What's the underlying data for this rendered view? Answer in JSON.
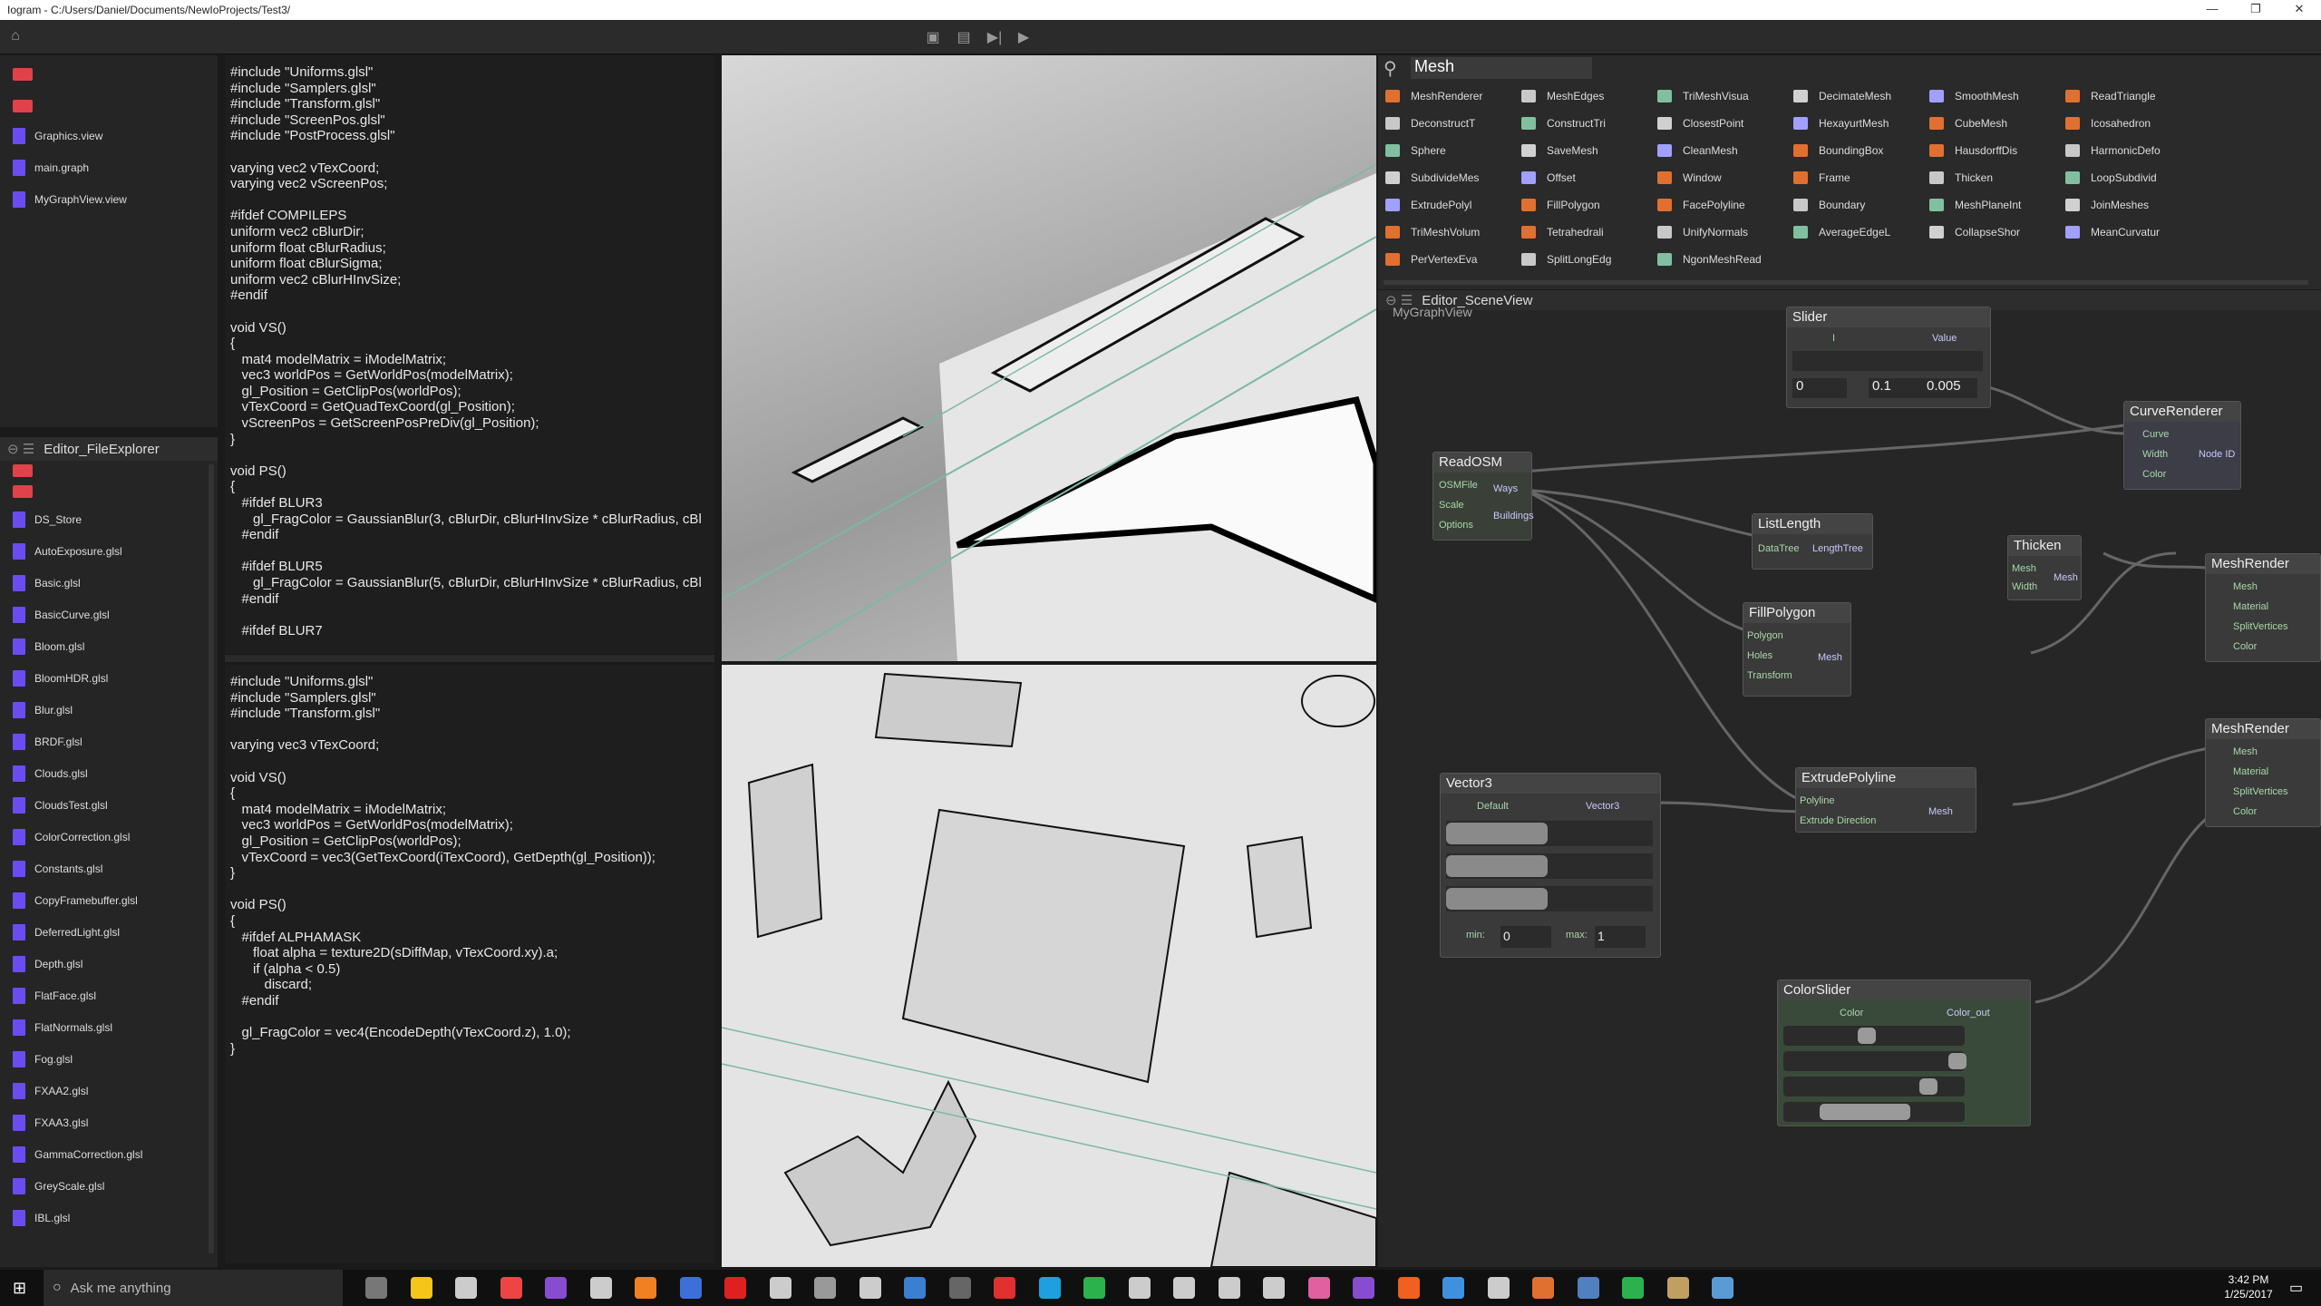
{
  "window": {
    "title": "Iogram - C:/Users/Daniel/Documents/NewIoProjects/Test3/",
    "minimize": "—",
    "maximize": "❐",
    "close": "✕"
  },
  "toolbar": {
    "home_icon": "home-icon",
    "buttons": [
      "open-icon",
      "save-icon",
      "step-icon",
      "play-icon"
    ]
  },
  "project_files": [
    {
      "name": ""
    },
    {
      "name": "."
    },
    {
      "name": "Graphics.view"
    },
    {
      "name": "main.graph"
    },
    {
      "name": "MyGraphView.view"
    }
  ],
  "file_explorer": {
    "title": "Editor_FileExplorer",
    "items": [
      "DS_Store",
      "AutoExposure.glsl",
      "Basic.glsl",
      "BasicCurve.glsl",
      "Bloom.glsl",
      "BloomHDR.glsl",
      "Blur.glsl",
      "BRDF.glsl",
      "Clouds.glsl",
      "CloudsTest.glsl",
      "ColorCorrection.glsl",
      "Constants.glsl",
      "CopyFramebuffer.glsl",
      "DeferredLight.glsl",
      "Depth.glsl",
      "FlatFace.glsl",
      "FlatNormals.glsl",
      "Fog.glsl",
      "FXAA2.glsl",
      "FXAA3.glsl",
      "GammaCorrection.glsl",
      "GreyScale.glsl",
      "IBL.glsl"
    ]
  },
  "code_top": "#include \"Uniforms.glsl\"\n#include \"Samplers.glsl\"\n#include \"Transform.glsl\"\n#include \"ScreenPos.glsl\"\n#include \"PostProcess.glsl\"\n\nvarying vec2 vTexCoord;\nvarying vec2 vScreenPos;\n\n#ifdef COMPILEPS\nuniform vec2 cBlurDir;\nuniform float cBlurRadius;\nuniform float cBlurSigma;\nuniform vec2 cBlurHInvSize;\n#endif\n\nvoid VS()\n{\n   mat4 modelMatrix = iModelMatrix;\n   vec3 worldPos = GetWorldPos(modelMatrix);\n   gl_Position = GetClipPos(worldPos);\n   vTexCoord = GetQuadTexCoord(gl_Position);\n   vScreenPos = GetScreenPosPreDiv(gl_Position);\n}\n\nvoid PS()\n{\n   #ifdef BLUR3\n      gl_FragColor = GaussianBlur(3, cBlurDir, cBlurHInvSize * cBlurRadius, cBl\n   #endif\n\n   #ifdef BLUR5\n      gl_FragColor = GaussianBlur(5, cBlurDir, cBlurHInvSize * cBlurRadius, cBl\n   #endif\n\n   #ifdef BLUR7",
  "code_bottom": "#include \"Uniforms.glsl\"\n#include \"Samplers.glsl\"\n#include \"Transform.glsl\"\n\nvarying vec3 vTexCoord;\n\nvoid VS()\n{\n   mat4 modelMatrix = iModelMatrix;\n   vec3 worldPos = GetWorldPos(modelMatrix);\n   gl_Position = GetClipPos(worldPos);\n   vTexCoord = vec3(GetTexCoord(iTexCoord), GetDepth(gl_Position));\n}\n\nvoid PS()\n{\n   #ifdef ALPHAMASK\n      float alpha = texture2D(sDiffMap, vTexCoord.xy).a;\n      if (alpha < 0.5)\n         discard;\n   #endif\n\n   gl_FragColor = vec4(EncodeDepth(vTexCoord.z), 1.0);\n}",
  "library": {
    "search": "Mesh",
    "columns": [
      [
        "MeshRenderer",
        "DeconstructT",
        "Sphere",
        "SubdivideMes",
        "ExtrudePolyl",
        "TriMeshVolum",
        "PerVertexEva"
      ],
      [
        "MeshEdges",
        "ConstructTri",
        "SaveMesh",
        "Offset",
        "FillPolygon",
        "Tetrahedrali",
        "SplitLongEdg"
      ],
      [
        "TriMeshVisua",
        "ClosestPoint",
        "CleanMesh",
        "Window",
        "FacePolyline",
        "UnifyNormals",
        "NgonMeshRead"
      ],
      [
        "DecimateMesh",
        "HexayurtMesh",
        "BoundingBox",
        "Frame",
        "Boundary",
        "AverageEdgeL"
      ],
      [
        "SmoothMesh",
        "CubeMesh",
        "HausdorffDis",
        "Thicken",
        "MeshPlaneInt",
        "CollapseShor"
      ],
      [
        "ReadTriangle",
        "Icosahedron",
        "HarmonicDefo",
        "LoopSubdivid",
        "JoinMeshes",
        "MeanCurvatur"
      ]
    ]
  },
  "scene": {
    "tab": "Editor_SceneView",
    "view_label": "MyGraphView"
  },
  "nodes": {
    "slider": {
      "title": "Slider",
      "in": "I",
      "out": "Value",
      "v1": "0",
      "v2": "0.1",
      "v3": "0.005"
    },
    "curve": {
      "title": "CurveRenderer",
      "ins": [
        "Curve",
        "Width",
        "Color"
      ],
      "out": "Node ID"
    },
    "readosm": {
      "title": "ReadOSM",
      "ins": [
        "OSMFile",
        "Scale",
        "Options"
      ],
      "outs": [
        "Ways",
        "Buildings"
      ]
    },
    "listlength": {
      "title": "ListLength",
      "in": "DataTree",
      "out": "LengthTree"
    },
    "thicken": {
      "title": "Thicken",
      "ins": [
        "Mesh",
        "Width"
      ],
      "out": "Mesh"
    },
    "meshr1": {
      "title": "MeshRender",
      "ins": [
        "Mesh",
        "Material",
        "SplitVertices",
        "Color"
      ]
    },
    "fillpoly": {
      "title": "FillPolygon",
      "ins": [
        "Polygon",
        "Holes",
        "Transform"
      ],
      "out": "Mesh"
    },
    "meshr2": {
      "title": "MeshRender",
      "ins": [
        "Mesh",
        "Material",
        "SplitVertices",
        "Color"
      ]
    },
    "vector3": {
      "title": "Vector3",
      "in": "Default",
      "out": "Vector3",
      "min_label": "min:",
      "min": "0",
      "max_label": "max:",
      "max": "1"
    },
    "extrude": {
      "title": "ExtrudePolyline",
      "ins": [
        "Polyline",
        "Extrude Direction"
      ],
      "out": "Mesh"
    },
    "colorslider": {
      "title": "ColorSlider",
      "in": "Color",
      "out": "Color_out"
    }
  },
  "taskbar": {
    "search": "Ask me anything",
    "time": "3:42 PM",
    "date": "1/25/2017"
  }
}
